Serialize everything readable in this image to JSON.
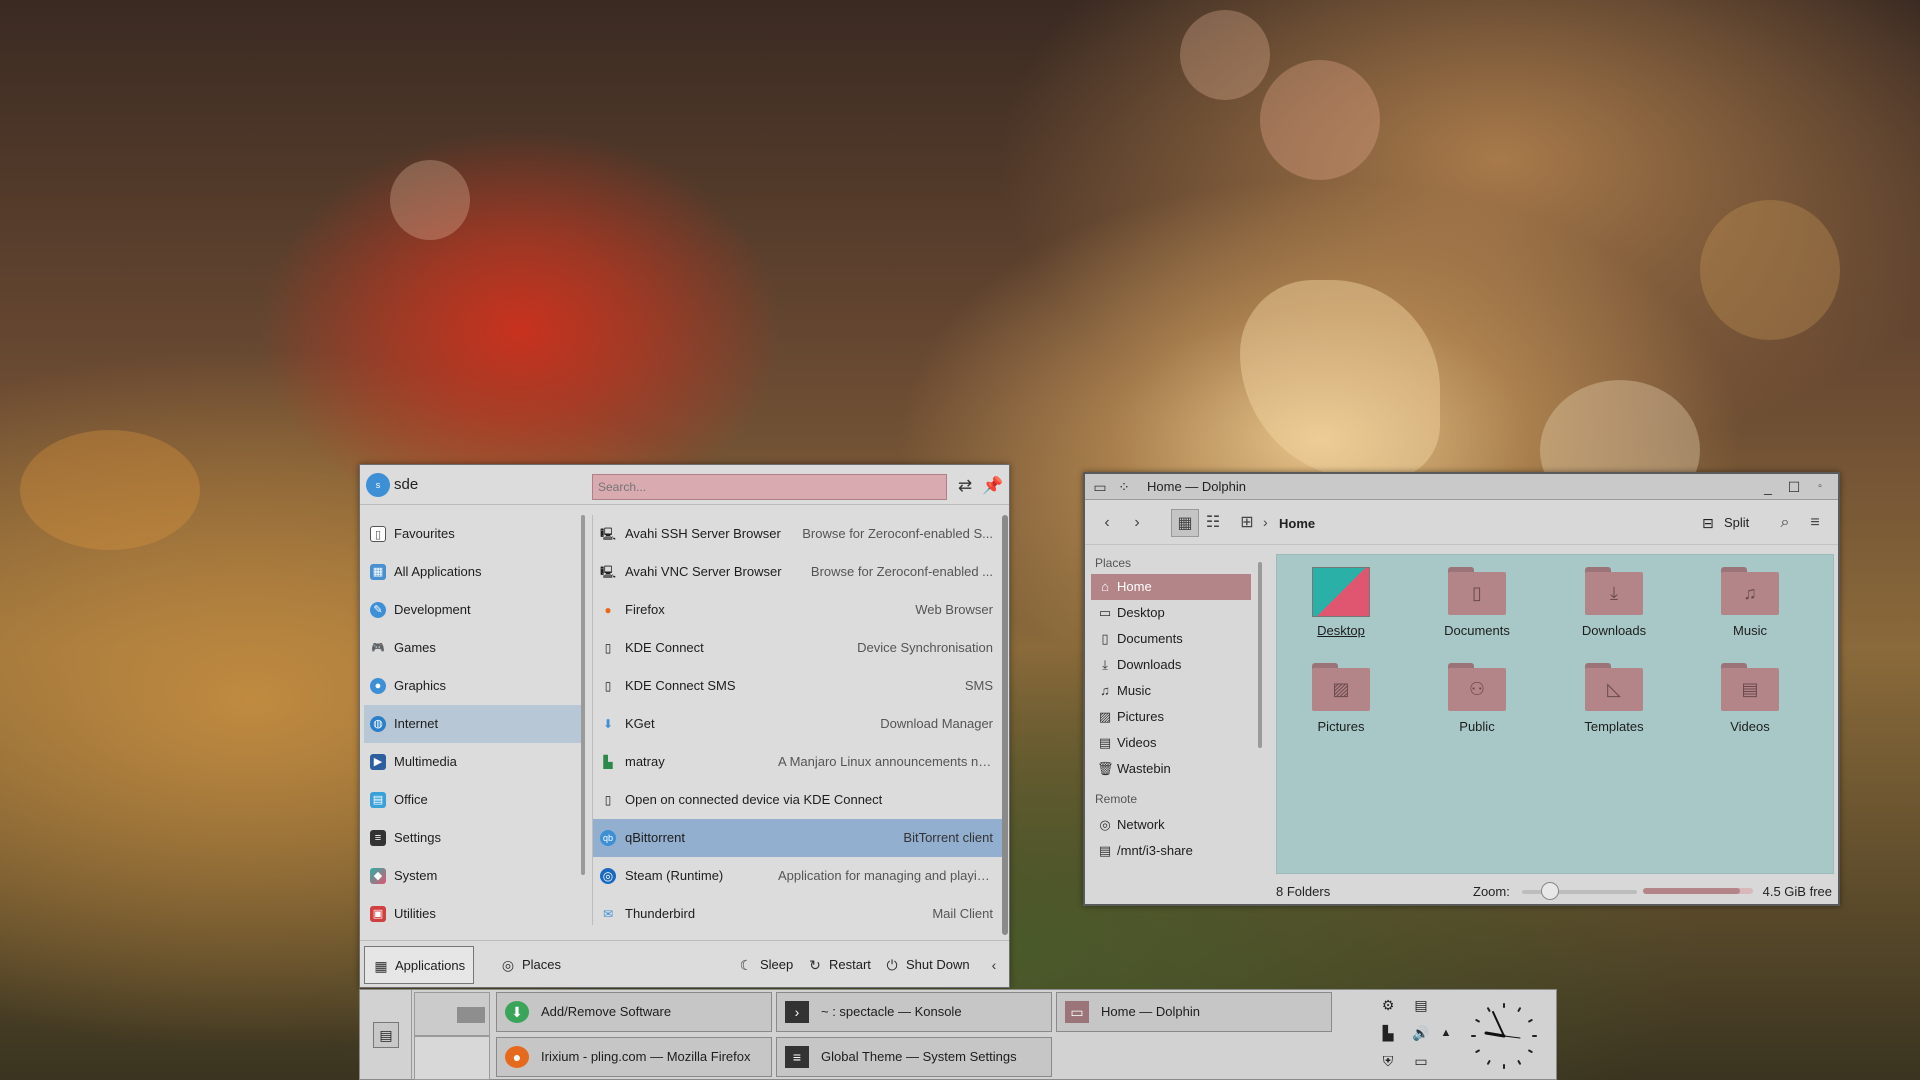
{
  "menu": {
    "user": {
      "initial": "s",
      "name": "sde"
    },
    "search": {
      "placeholder": "Search..."
    },
    "categories": [
      {
        "label": "Favourites",
        "icon": "bookmark-icon"
      },
      {
        "label": "All Applications",
        "icon": "grid-icon"
      },
      {
        "label": "Development",
        "icon": "development-icon"
      },
      {
        "label": "Games",
        "icon": "gamepad-icon"
      },
      {
        "label": "Graphics",
        "icon": "graphics-icon"
      },
      {
        "label": "Internet",
        "icon": "globe-icon"
      },
      {
        "label": "Multimedia",
        "icon": "multimedia-icon"
      },
      {
        "label": "Office",
        "icon": "office-icon"
      },
      {
        "label": "Settings",
        "icon": "settings-icon"
      },
      {
        "label": "System",
        "icon": "system-icon"
      },
      {
        "label": "Utilities",
        "icon": "toolbox-icon"
      }
    ],
    "apps": [
      {
        "name": "Avahi SSH Server Browser",
        "desc": "Browse for Zeroconf-enabled S..."
      },
      {
        "name": "Avahi VNC Server Browser",
        "desc": "Browse for Zeroconf-enabled ..."
      },
      {
        "name": "Firefox",
        "desc": "Web Browser"
      },
      {
        "name": "KDE Connect",
        "desc": "Device Synchronisation"
      },
      {
        "name": "KDE Connect SMS",
        "desc": "SMS"
      },
      {
        "name": "KGet",
        "desc": "Download Manager"
      },
      {
        "name": "matray",
        "desc": "A Manjaro Linux announcements notification app"
      },
      {
        "name": "Open on connected device via KDE Connect",
        "desc": ""
      },
      {
        "name": "qBittorrent",
        "desc": "BitTorrent client"
      },
      {
        "name": "Steam (Runtime)",
        "desc": "Application for managing and playing g..."
      },
      {
        "name": "Thunderbird",
        "desc": "Mail Client"
      }
    ],
    "footer": {
      "applications": "Applications",
      "places": "Places",
      "sleep": "Sleep",
      "restart": "Restart",
      "shutdown": "Shut Down"
    }
  },
  "dolphin": {
    "title": "Home — Dolphin",
    "breadcrumb": "Home",
    "split": "Split",
    "places_header": "Places",
    "places": [
      {
        "label": "Home",
        "icon": "home-icon"
      },
      {
        "label": "Desktop",
        "icon": "desktop-icon"
      },
      {
        "label": "Documents",
        "icon": "documents-icon"
      },
      {
        "label": "Downloads",
        "icon": "downloads-icon"
      },
      {
        "label": "Music",
        "icon": "music-icon"
      },
      {
        "label": "Pictures",
        "icon": "pictures-icon"
      },
      {
        "label": "Videos",
        "icon": "videos-icon"
      },
      {
        "label": "Wastebin",
        "icon": "trash-icon"
      }
    ],
    "remote_header": "Remote",
    "remote": [
      {
        "label": "Network",
        "icon": "network-icon"
      },
      {
        "label": "/mnt/i3-share",
        "icon": "drive-icon"
      }
    ],
    "folders": [
      {
        "label": "Desktop",
        "icon": "desktop-folder-icon"
      },
      {
        "label": "Documents",
        "icon": "documents-folder-icon"
      },
      {
        "label": "Downloads",
        "icon": "downloads-folder-icon"
      },
      {
        "label": "Music",
        "icon": "music-folder-icon"
      },
      {
        "label": "Pictures",
        "icon": "pictures-folder-icon"
      },
      {
        "label": "Public",
        "icon": "public-folder-icon"
      },
      {
        "label": "Templates",
        "icon": "templates-folder-icon"
      },
      {
        "label": "Videos",
        "icon": "videos-folder-icon"
      }
    ],
    "status": {
      "count": "8 Folders",
      "zoom_label": "Zoom:",
      "free": "4.5 GiB free"
    }
  },
  "taskbar": {
    "tasks": [
      {
        "label": "Add/Remove Software",
        "icon": "software-icon"
      },
      {
        "label": "~ : spectacle — Konsole",
        "icon": "konsole-icon"
      },
      {
        "label": "Home — Dolphin",
        "icon": "dolphin-icon"
      },
      {
        "label": "Irixium - pling.com — Mozilla Firefox",
        "icon": "firefox-icon"
      },
      {
        "label": "Global Theme — System Settings",
        "icon": "settings-icon"
      }
    ],
    "tray": [
      "kde-connect-icon",
      "clipboard-icon",
      "network-icon",
      "volume-icon",
      "expand-arrow-icon",
      "shield-icon",
      "display-icon"
    ]
  },
  "colors": {
    "accent_selection": "#93afd0",
    "places_selection": "#b48588",
    "view_background": "#a8c8c8",
    "search_background": "#d9aab0"
  }
}
